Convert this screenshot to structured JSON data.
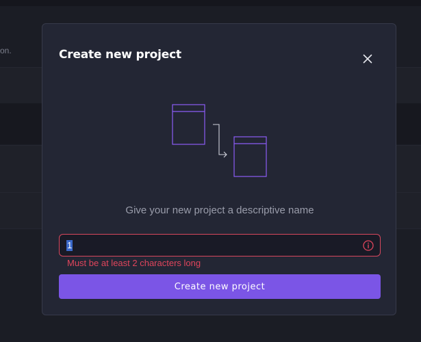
{
  "background": {
    "partial_text": "on."
  },
  "modal": {
    "title": "Create new project",
    "close_icon": "close-icon",
    "illustration_icon": "project-move-illustration",
    "subtitle": "Give your new project a descriptive name",
    "input": {
      "value": "1",
      "error_icon": "info-circle-icon"
    },
    "error_message": "Must be at least 2 characters long",
    "submit_label": "Create new project"
  },
  "colors": {
    "accent": "#7b55e6",
    "error": "#e0455c",
    "modal_bg": "#232634",
    "illustration": "#8b5cf6"
  }
}
